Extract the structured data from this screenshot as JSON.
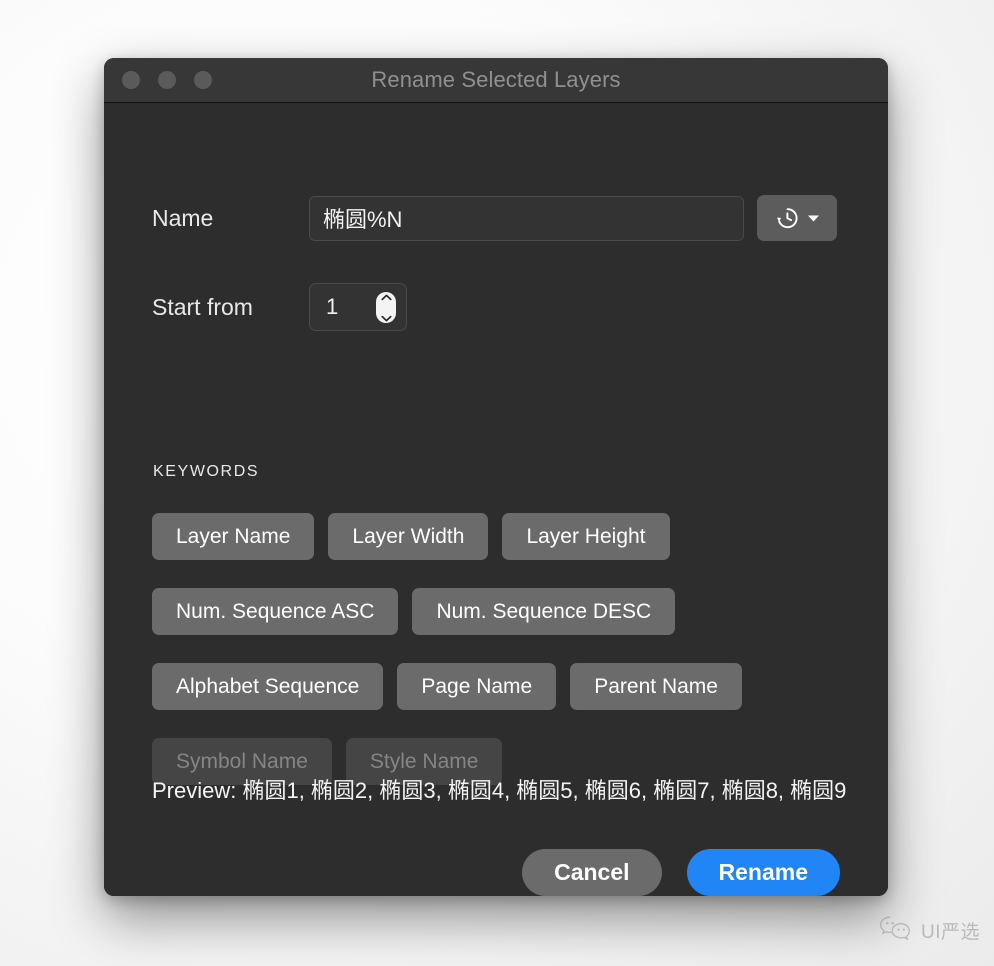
{
  "window": {
    "title": "Rename Selected Layers",
    "traffic_lights": [
      "close-button",
      "minimize-button",
      "zoom-button"
    ]
  },
  "form": {
    "name_label": "Name",
    "name_value": "椭圆%N",
    "name_placeholder": "",
    "history_icon": "history-clock-icon",
    "history_dropdown_icon": "chevron-down-icon",
    "start_label": "Start from",
    "start_value": "1",
    "stepper_up_icon": "chevron-up-icon",
    "stepper_down_icon": "chevron-down-icon"
  },
  "keywords": {
    "section_title": "KEYWORDS",
    "items": [
      {
        "label": "Layer Name",
        "disabled": false
      },
      {
        "label": "Layer Width",
        "disabled": false
      },
      {
        "label": "Layer Height",
        "disabled": false
      },
      {
        "label": "Num. Sequence ASC",
        "disabled": false
      },
      {
        "label": "Num. Sequence DESC",
        "disabled": false
      },
      {
        "label": "Alphabet Sequence",
        "disabled": false
      },
      {
        "label": "Page Name",
        "disabled": false
      },
      {
        "label": "Parent Name",
        "disabled": false
      },
      {
        "label": "Symbol Name",
        "disabled": true
      },
      {
        "label": "Style Name",
        "disabled": true
      }
    ]
  },
  "preview": {
    "text": "Preview: 椭圆1, 椭圆2, 椭圆3, 椭圆4, 椭圆5, 椭圆6, 椭圆7, 椭圆8, 椭圆9"
  },
  "footer": {
    "cancel_label": "Cancel",
    "rename_label": "Rename"
  },
  "watermark": {
    "icon": "wechat-logo-icon",
    "text": "UI严选"
  },
  "colors": {
    "accent": "#2185f5",
    "window_bg": "#2d2d2d",
    "titlebar_bg": "#373737",
    "keyword_btn": "#6b6b6b",
    "keyword_btn_disabled": "#454545"
  }
}
